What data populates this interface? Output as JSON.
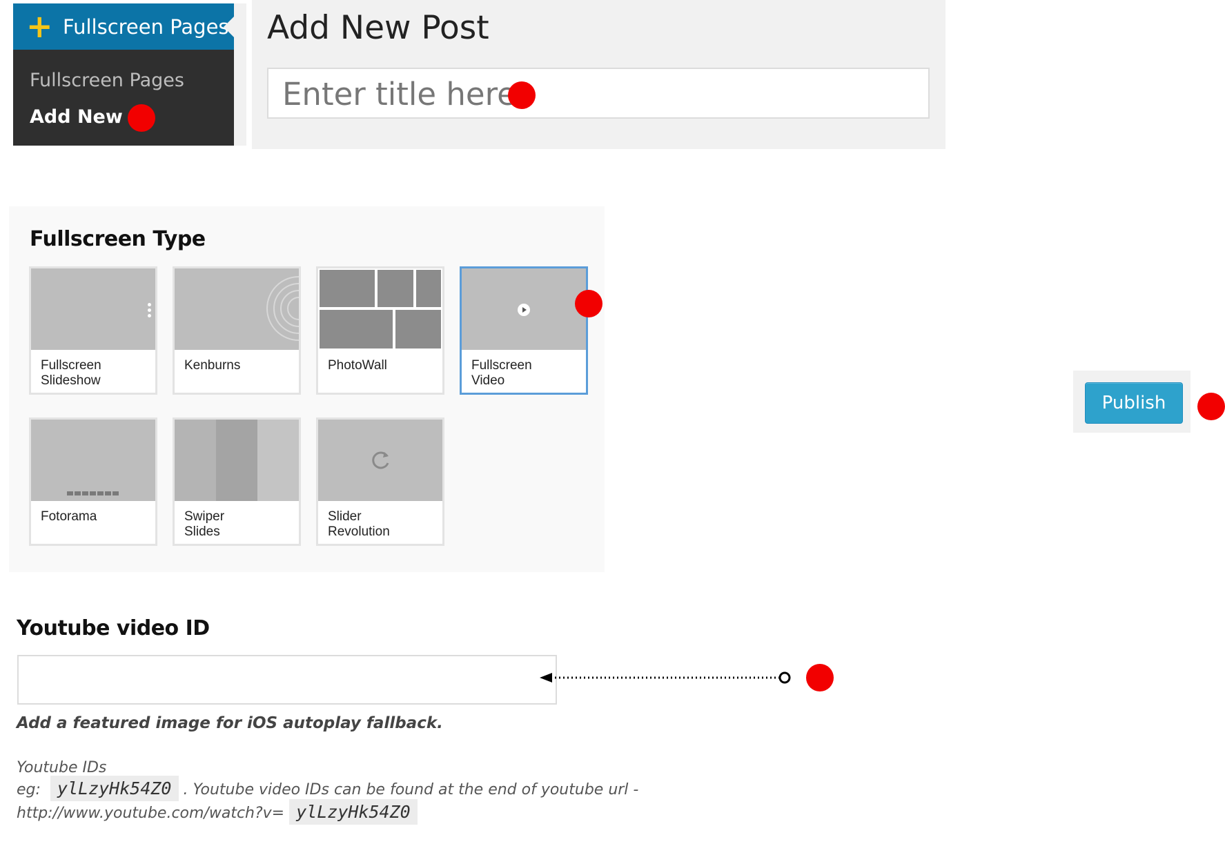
{
  "sidebar": {
    "menu_title": "Fullscreen Pages",
    "items": [
      {
        "label": "Fullscreen Pages",
        "current": false
      },
      {
        "label": "Add New",
        "current": true
      }
    ]
  },
  "header": {
    "page_title": "Add New Post",
    "title_placeholder": "Enter title here"
  },
  "fullscreen_type": {
    "heading": "Fullscreen Type",
    "options": [
      {
        "label": "Fullscreen\nSlideshow",
        "selected": false
      },
      {
        "label": "Kenburns",
        "selected": false
      },
      {
        "label": "PhotoWall",
        "selected": false
      },
      {
        "label": "Fullscreen\nVideo",
        "selected": true
      },
      {
        "label": "Fotorama",
        "selected": false
      },
      {
        "label": "Swiper\nSlides",
        "selected": false
      },
      {
        "label": "Slider\nRevolution",
        "selected": false
      }
    ]
  },
  "publish": {
    "label": "Publish"
  },
  "youtube": {
    "heading": "Youtube video ID",
    "value": "",
    "note": "Add a featured image for iOS autoplay fallback.",
    "ids_label": "Youtube IDs",
    "eg_prefix": "eg:",
    "example_id": "ylLzyHk54Z0",
    "line2_suffix": ". Youtube video IDs can be found at the end of youtube url -",
    "url_prefix": "http://www.youtube.com/watch?v="
  },
  "colors": {
    "menu_bg": "#2f2f2f",
    "menu_active": "#0c74a7",
    "plus_icon": "#f5c518",
    "selected_border": "#5b9dd9",
    "publish_button": "#2ea2cc",
    "marker": "#f20000"
  },
  "icons": [
    "plus-icon",
    "menu-pointer-icon",
    "play-icon",
    "refresh-icon",
    "arrow-left-icon"
  ]
}
